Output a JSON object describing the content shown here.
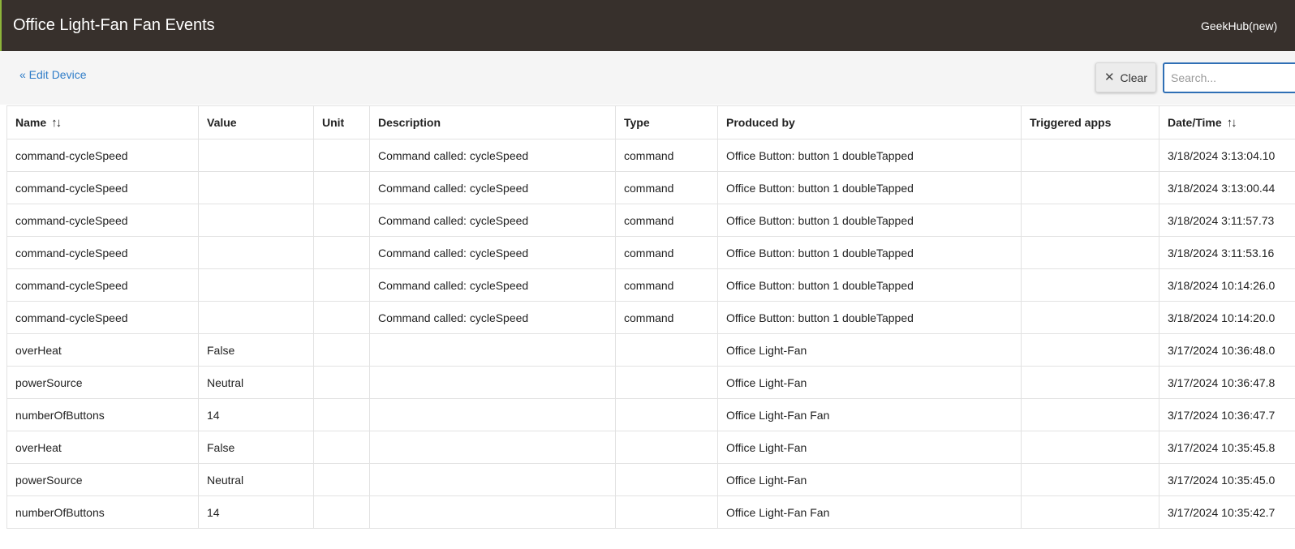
{
  "header": {
    "title": "Office Light-Fan Fan Events",
    "hub_name": "GeekHub(new)"
  },
  "toolbar": {
    "back_link": "« Edit Device",
    "clear_label": "Clear",
    "search_placeholder": "Search..."
  },
  "icons": {
    "clear": "close-icon",
    "sort": "sort-arrows-icon"
  },
  "colors": {
    "header_bg": "#37302c",
    "link": "#2f7dc8",
    "search_border": "#2f6fb5"
  },
  "table": {
    "columns": [
      "Name",
      "Value",
      "Unit",
      "Description",
      "Type",
      "Produced by",
      "Triggered apps",
      "Date/Time"
    ],
    "sortable_columns": [
      "Name",
      "Date/Time"
    ],
    "rows": [
      {
        "name": "command-cycleSpeed",
        "value": "",
        "unit": "",
        "description": "Command called: cycleSpeed",
        "type": "command",
        "produced_by": "Office Button: button 1 doubleTapped",
        "triggered_apps": "",
        "datetime": "3/18/2024 3:13:04.10"
      },
      {
        "name": "command-cycleSpeed",
        "value": "",
        "unit": "",
        "description": "Command called: cycleSpeed",
        "type": "command",
        "produced_by": "Office Button: button 1 doubleTapped",
        "triggered_apps": "",
        "datetime": "3/18/2024 3:13:00.44"
      },
      {
        "name": "command-cycleSpeed",
        "value": "",
        "unit": "",
        "description": "Command called: cycleSpeed",
        "type": "command",
        "produced_by": "Office Button: button 1 doubleTapped",
        "triggered_apps": "",
        "datetime": "3/18/2024 3:11:57.73"
      },
      {
        "name": "command-cycleSpeed",
        "value": "",
        "unit": "",
        "description": "Command called: cycleSpeed",
        "type": "command",
        "produced_by": "Office Button: button 1 doubleTapped",
        "triggered_apps": "",
        "datetime": "3/18/2024 3:11:53.16"
      },
      {
        "name": "command-cycleSpeed",
        "value": "",
        "unit": "",
        "description": "Command called: cycleSpeed",
        "type": "command",
        "produced_by": "Office Button: button 1 doubleTapped",
        "triggered_apps": "",
        "datetime": "3/18/2024 10:14:26.0"
      },
      {
        "name": "command-cycleSpeed",
        "value": "",
        "unit": "",
        "description": "Command called: cycleSpeed",
        "type": "command",
        "produced_by": "Office Button: button 1 doubleTapped",
        "triggered_apps": "",
        "datetime": "3/18/2024 10:14:20.0"
      },
      {
        "name": "overHeat",
        "value": "False",
        "unit": "",
        "description": "",
        "type": "",
        "produced_by": "Office Light-Fan",
        "triggered_apps": "",
        "datetime": "3/17/2024 10:36:48.0"
      },
      {
        "name": "powerSource",
        "value": "Neutral",
        "unit": "",
        "description": "",
        "type": "",
        "produced_by": "Office Light-Fan",
        "triggered_apps": "",
        "datetime": "3/17/2024 10:36:47.8"
      },
      {
        "name": "numberOfButtons",
        "value": "14",
        "unit": "",
        "description": "",
        "type": "",
        "produced_by": "Office Light-Fan Fan",
        "triggered_apps": "",
        "datetime": "3/17/2024 10:36:47.7"
      },
      {
        "name": "overHeat",
        "value": "False",
        "unit": "",
        "description": "",
        "type": "",
        "produced_by": "Office Light-Fan",
        "triggered_apps": "",
        "datetime": "3/17/2024 10:35:45.8"
      },
      {
        "name": "powerSource",
        "value": "Neutral",
        "unit": "",
        "description": "",
        "type": "",
        "produced_by": "Office Light-Fan",
        "triggered_apps": "",
        "datetime": "3/17/2024 10:35:45.0"
      },
      {
        "name": "numberOfButtons",
        "value": "14",
        "unit": "",
        "description": "",
        "type": "",
        "produced_by": "Office Light-Fan Fan",
        "triggered_apps": "",
        "datetime": "3/17/2024 10:35:42.7"
      }
    ]
  }
}
